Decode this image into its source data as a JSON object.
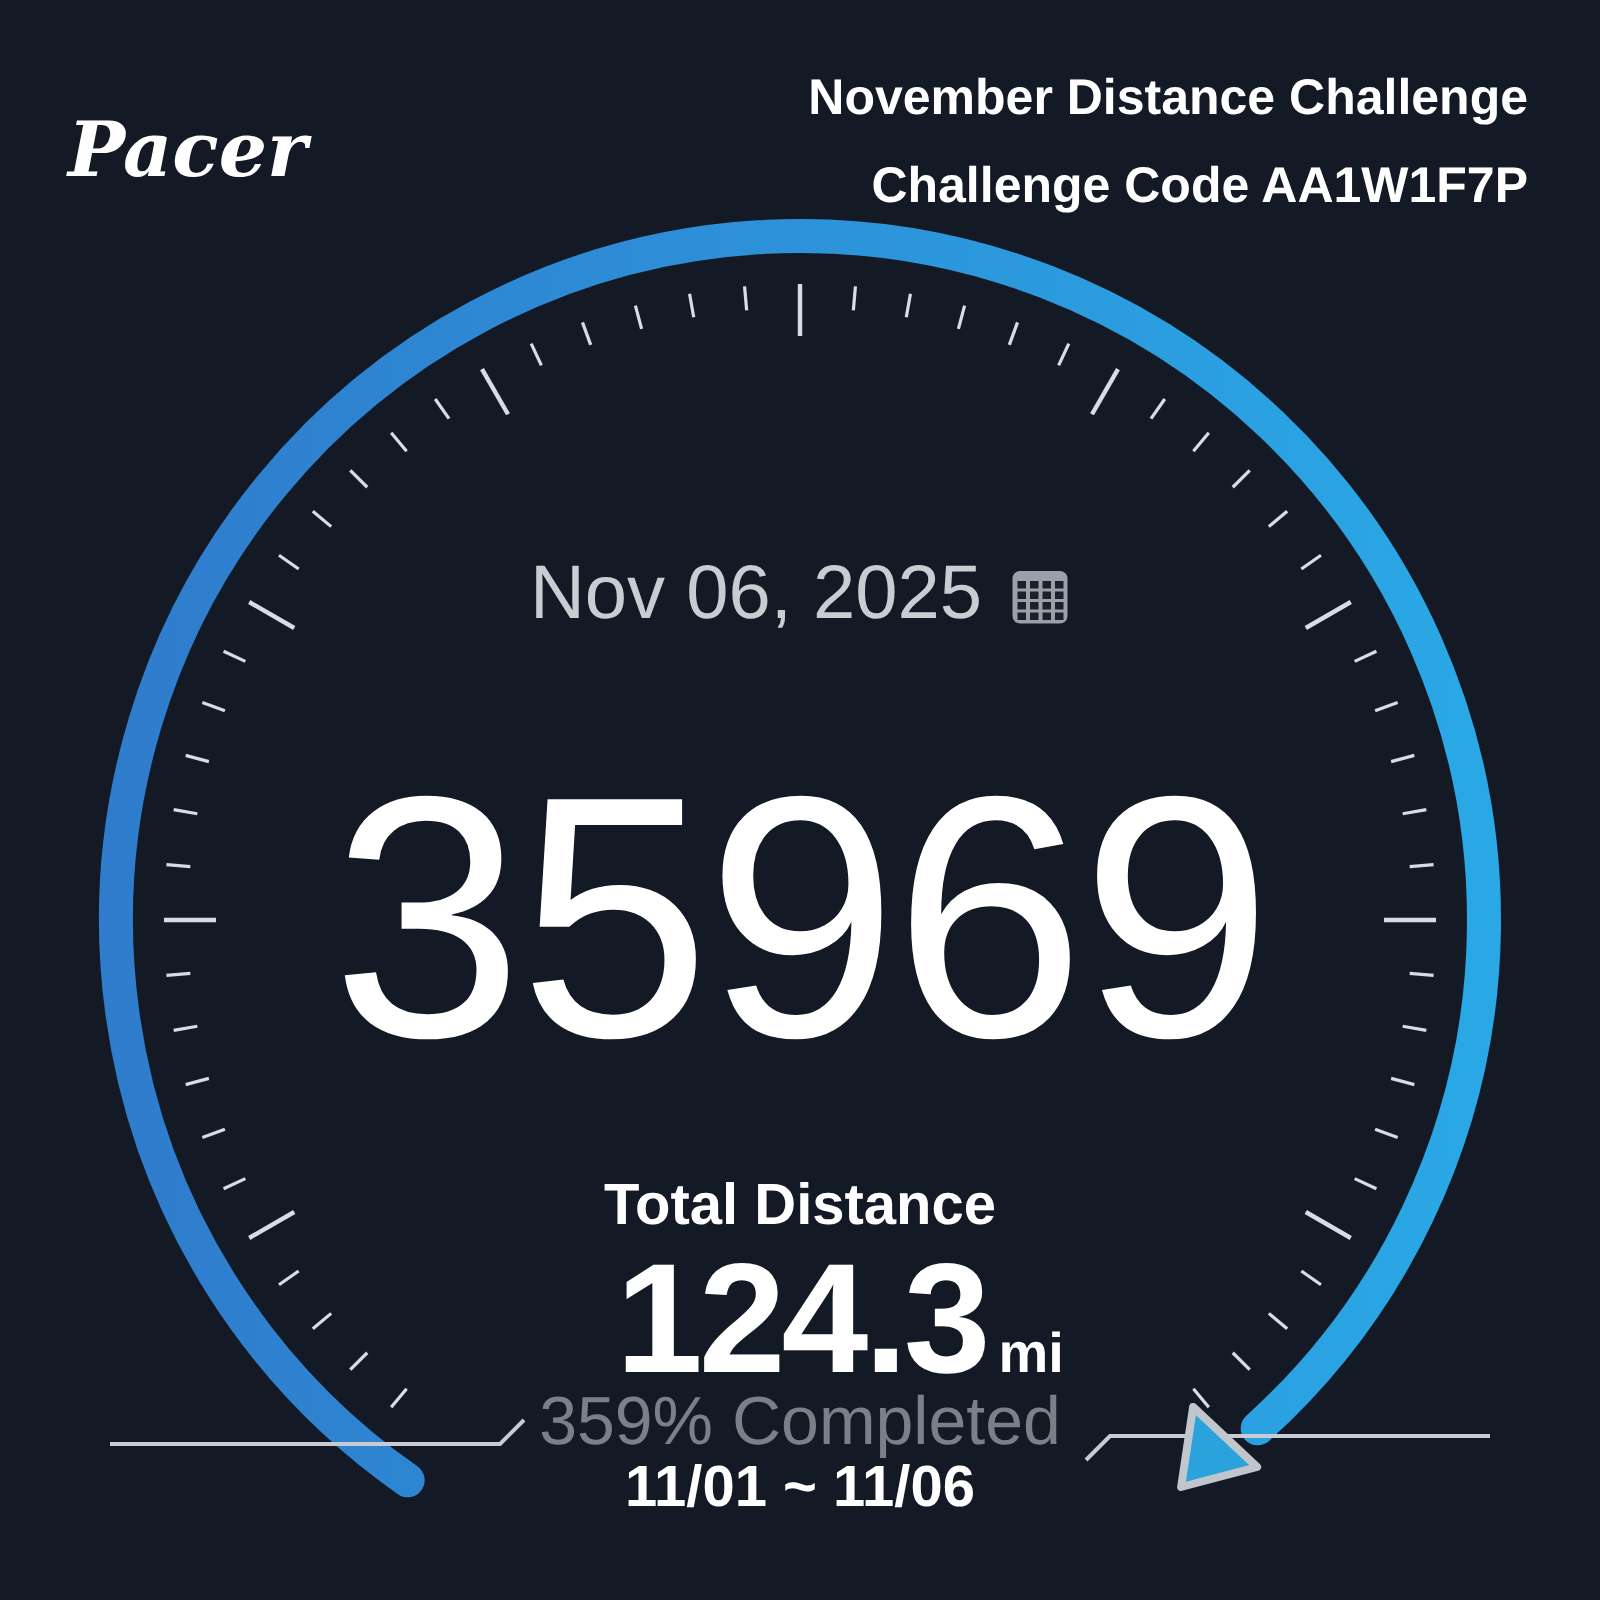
{
  "app": {
    "logo": "Pacer"
  },
  "challenge": {
    "title": "November Distance Challenge",
    "code": "Challenge Code AA1W1F7P"
  },
  "date": "Nov 06, 2025",
  "steps": "35969",
  "total_label": "Total Distance",
  "distance": {
    "value": "124.3",
    "unit": "mi"
  },
  "progress": "359% Completed",
  "range": "11/01 ~ 11/06"
}
